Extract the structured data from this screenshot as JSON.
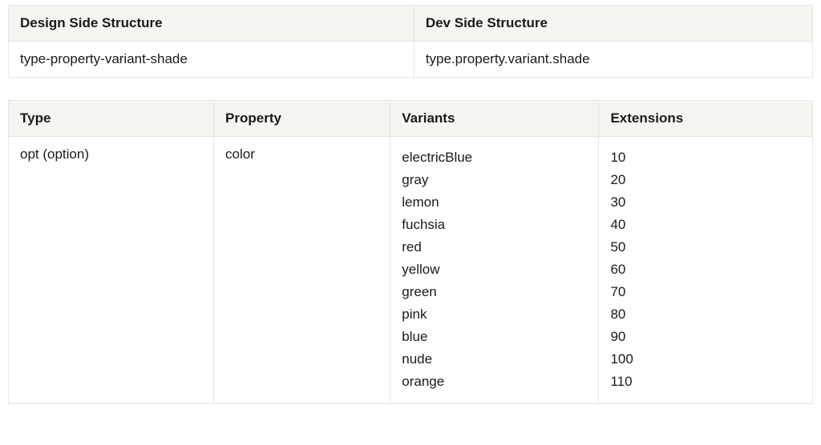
{
  "table1": {
    "headers": [
      "Design Side Structure",
      "Dev Side Structure"
    ],
    "row": [
      "type-property-variant-shade",
      "type.property.variant.shade"
    ]
  },
  "table2": {
    "headers": [
      "Type",
      "Property",
      "Variants",
      "Extensions"
    ],
    "row": {
      "type": "opt (option)",
      "property": "color",
      "variants": [
        "electricBlue",
        "gray",
        "lemon",
        "fuchsia",
        "red",
        "yellow",
        "green",
        "pink",
        "blue",
        "nude",
        "orange"
      ],
      "extensions": [
        "10",
        "20",
        "30",
        "40",
        "50",
        "60",
        "70",
        "80",
        "90",
        "100",
        "110"
      ]
    }
  }
}
